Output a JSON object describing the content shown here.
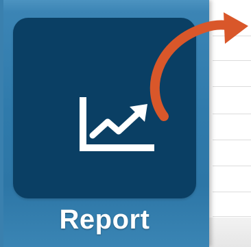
{
  "app_tile": {
    "label": "Report",
    "icon": "line-chart-trending-up-icon"
  },
  "colors": {
    "panel_background": "#2f7aab",
    "tile_background": "#0a3f64",
    "icon_color": "#ffffff",
    "label_color": "#ffffff",
    "arrow_color": "#d9572a"
  },
  "pointer": {
    "icon": "curved-arrow-icon"
  }
}
